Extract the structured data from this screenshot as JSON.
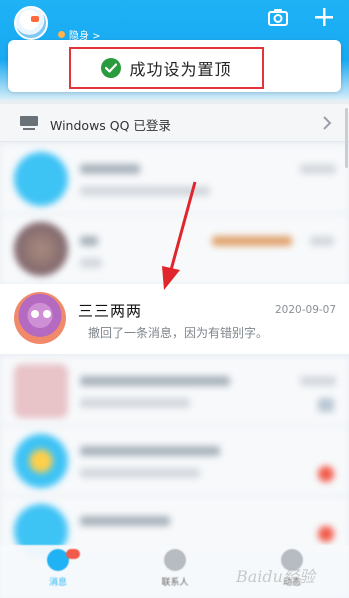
{
  "header": {
    "status_text": "隐身 >",
    "status_color": "#ffb34d",
    "brand_color": "#1fb2f5",
    "icons": [
      "avatar",
      "camera-icon",
      "plus-icon"
    ]
  },
  "toast": {
    "text": "成功设为置顶",
    "icon": "check-circle-icon",
    "check_color": "#2a9b3f",
    "highlight_border": "#e0363b"
  },
  "login_bar": {
    "label": "Windows QQ 已登录",
    "icon": "monitor-icon"
  },
  "pinned_chat": {
    "name": "三三两两",
    "date": "2020-09-07",
    "message": "撤回了一条消息，因为有错别字。"
  },
  "bottom_nav": {
    "items": [
      {
        "label": "消息"
      },
      {
        "label": "联系人"
      },
      {
        "label": "动态"
      }
    ]
  },
  "watermark": "Baidu经验"
}
